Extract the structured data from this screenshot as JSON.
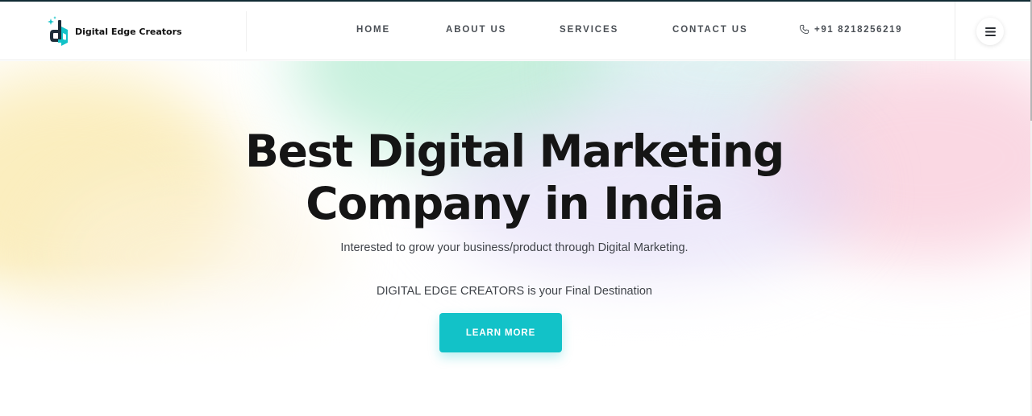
{
  "brand": {
    "name": "Digital Edge Creators",
    "logo_icon": "de-monogram-icon",
    "accent": "#12c2c8",
    "dark": "#1d2d3a"
  },
  "nav": {
    "items": [
      {
        "label": "HOME"
      },
      {
        "label": "ABOUT US"
      },
      {
        "label": "SERVICES"
      },
      {
        "label": "CONTACT US"
      }
    ],
    "phone": {
      "icon": "phone-icon",
      "label": "+91 8218256219"
    },
    "menu_icon": "hamburger-menu-icon"
  },
  "hero": {
    "title_line1": "Best Digital Marketing",
    "title_line2": "Company in India",
    "subtitle": "Interested to grow your business/product through Digital Marketing.",
    "tagline": "DIGITAL EDGE CREATORS is your Final Destination",
    "cta_label": "LEARN MORE",
    "cta_color": "#12c2c8"
  }
}
